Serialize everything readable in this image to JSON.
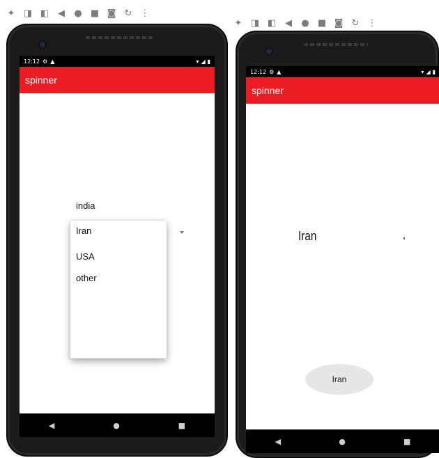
{
  "left_panel": {
    "toolbar_icons": [
      "power-icon",
      "volume-up-icon",
      "volume-down-icon",
      "back-icon",
      "home-icon",
      "overview-icon",
      "camera-icon",
      "rotate-icon",
      "more-icon"
    ],
    "status_time": "12:12",
    "app_title": "spinner",
    "dropdown_items": [
      "india",
      "Iran",
      "USA",
      "other"
    ]
  },
  "right_panel": {
    "toolbar_icons": [
      "power-icon",
      "volume-up-icon",
      "volume-down-icon",
      "back-icon",
      "home-icon",
      "overview-icon",
      "camera-icon",
      "rotate-icon",
      "more-icon"
    ],
    "status_time": "12:12",
    "app_title": "spinner",
    "selected_value": "Iran",
    "toast_text": "Iran"
  },
  "colors": {
    "app_bar": "#ec1c24",
    "status_bar": "#000000",
    "nav_bar": "#000000",
    "toast_bg": "#e6e6e6"
  }
}
